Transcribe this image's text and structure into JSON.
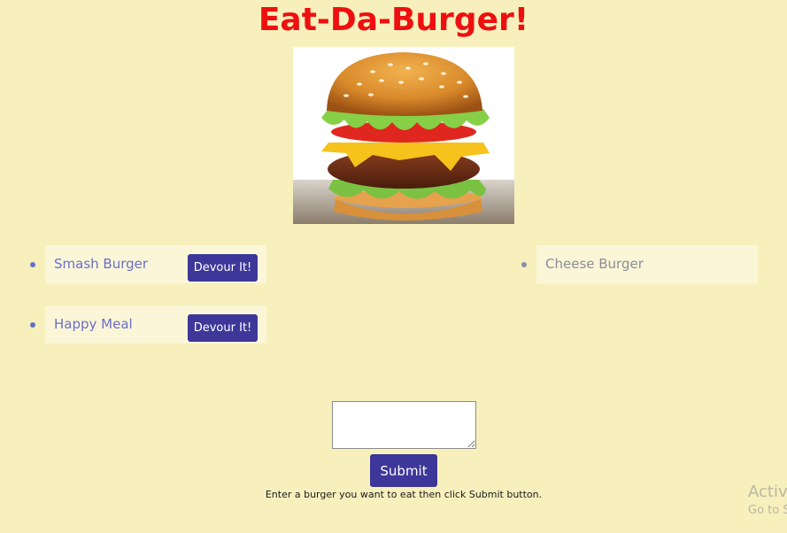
{
  "page": {
    "title": "Eat-Da-Burger!",
    "hero_image": "burger-photo"
  },
  "burgers_to_eat": [
    {
      "name": "Smash Burger",
      "button_label": "Devour It!"
    },
    {
      "name": "Happy Meal",
      "button_label": "Devour It!"
    }
  ],
  "devoured_burgers": [
    {
      "name": "Cheese Burger"
    }
  ],
  "form": {
    "input_value": "",
    "submit_label": "Submit",
    "hint": "Enter a burger you want to eat then click Submit button."
  },
  "watermark": {
    "line1": "Activate Windows",
    "line2": "Go to Settings to activate Windows."
  },
  "colors": {
    "background": "#f7f0bd",
    "title": "#ee1010",
    "button": "#3d3799",
    "item_background": "#fbf6d8",
    "item_text": "#6a6fc7"
  }
}
